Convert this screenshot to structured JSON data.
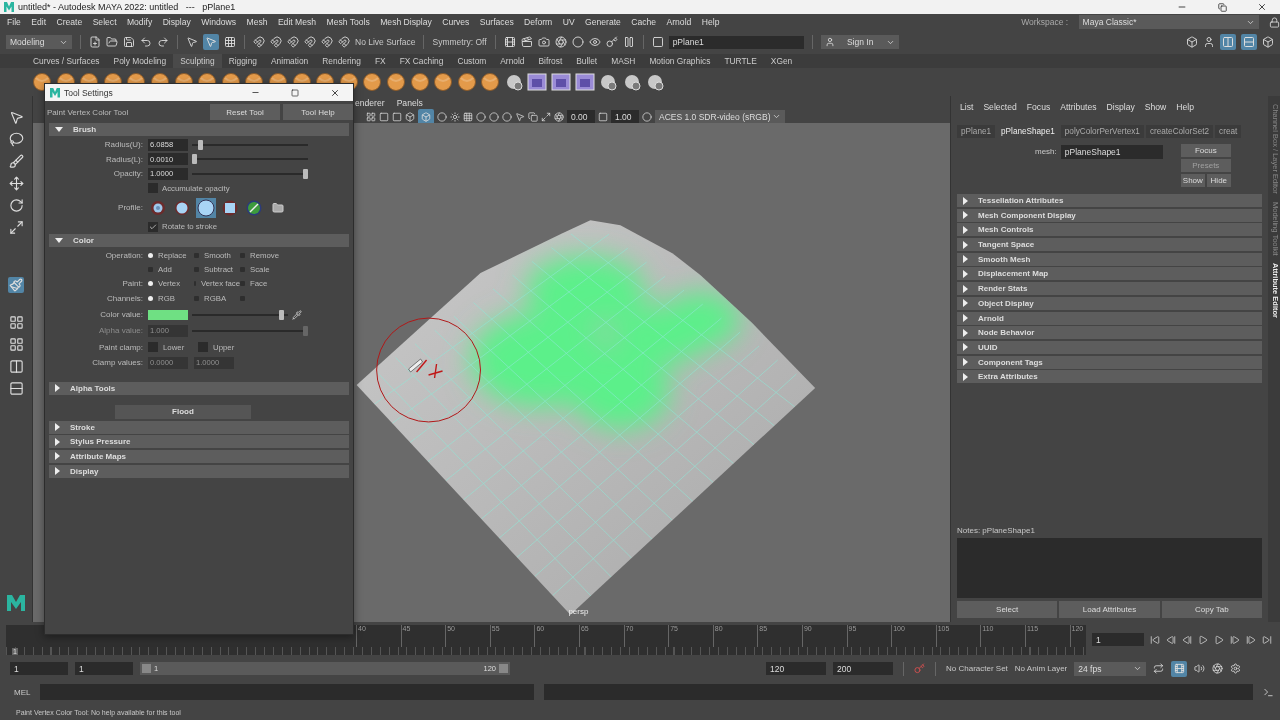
{
  "window": {
    "title": "untitled* - Autodesk MAYA 2022: untitled   ---   pPlane1"
  },
  "menu": [
    "File",
    "Edit",
    "Create",
    "Select",
    "Modify",
    "Display",
    "Windows",
    "Mesh",
    "Edit Mesh",
    "Mesh Tools",
    "Mesh Display",
    "Curves",
    "Surfaces",
    "Deform",
    "UV",
    "Generate",
    "Cache",
    "Arnold",
    "Help"
  ],
  "workspace": {
    "label": "Workspace :",
    "value": "Maya Classic*"
  },
  "status_line": {
    "mode": "Modeling",
    "live_surface": "No Live Surface",
    "symmetry": "Symmetry: Off",
    "object_field": "pPlane1",
    "sign_in": "Sign In"
  },
  "shelf_tabs": [
    {
      "label": "Curves / Surfaces",
      "selected": false
    },
    {
      "label": "Poly Modeling",
      "selected": false
    },
    {
      "label": "Sculpting",
      "selected": true
    },
    {
      "label": "Rigging",
      "selected": false
    },
    {
      "label": "Animation",
      "selected": false
    },
    {
      "label": "Rendering",
      "selected": false
    },
    {
      "label": "FX",
      "selected": false
    },
    {
      "label": "FX Caching",
      "selected": false
    },
    {
      "label": "Custom",
      "selected": false
    },
    {
      "label": "Arnold",
      "selected": false
    },
    {
      "label": "Bifrost",
      "selected": false
    },
    {
      "label": "Bullet",
      "selected": false
    },
    {
      "label": "MASH",
      "selected": false
    },
    {
      "label": "Motion Graphics",
      "selected": false
    },
    {
      "label": "TURTLE",
      "selected": false
    },
    {
      "label": "XGen",
      "selected": false
    }
  ],
  "viewport": {
    "menu": [
      "enderer",
      "Panels"
    ],
    "exposure": "0.00",
    "gamma": "1.00",
    "color_space": "ACES 1.0 SDR-video (sRGB)",
    "camera": "persp"
  },
  "tool_settings": {
    "title": "Tool Settings",
    "tool_name": "Paint Vertex Color Tool",
    "buttons": [
      "Reset Tool",
      "Tool Help"
    ],
    "brush": {
      "label": "Brush",
      "expanded": true,
      "sliders": [
        {
          "label": "Radius(U):",
          "value": "6.0858",
          "level": 0.05
        },
        {
          "label": "Radius(L):",
          "value": "0.0010",
          "level": 0.0
        },
        {
          "label": "Opacity:",
          "value": "1.0000",
          "level": 1.0
        }
      ],
      "accumulate": {
        "label": "Accumulate opacity",
        "checked": false
      },
      "profile": {
        "label": "Profile:",
        "shapes": [
          {
            "kind": "gaussian",
            "selected": false
          },
          {
            "kind": "soft",
            "selected": false
          },
          {
            "kind": "solid",
            "selected": true
          },
          {
            "kind": "square",
            "selected": false
          },
          {
            "kind": "image",
            "selected": false
          },
          {
            "kind": "folder",
            "selected": false
          }
        ]
      },
      "rotate": {
        "label": "Rotate to stroke",
        "checked": true
      }
    },
    "color": {
      "label": "Color",
      "expanded": true,
      "radio_groups": [
        {
          "label": "Operation:",
          "options": [
            {
              "label": "Replace",
              "selected": true
            },
            {
              "label": "Smooth",
              "selected": false
            },
            {
              "label": "Remove",
              "selected": false
            },
            {
              "label": "Add",
              "selected": false
            },
            {
              "label": "Subtract",
              "selected": false
            },
            {
              "label": "Scale",
              "selected": false
            }
          ]
        },
        {
          "label": "Paint:",
          "options": [
            {
              "label": "Vertex",
              "selected": true
            },
            {
              "label": "Vertex face",
              "selected": false
            },
            {
              "label": "Face",
              "selected": false
            }
          ]
        },
        {
          "label": "Channels:",
          "options": [
            {
              "label": "RGB",
              "selected": true
            },
            {
              "label": "RGBA",
              "selected": false
            },
            {
              "selected": false
            }
          ]
        }
      ],
      "color_value": {
        "label": "Color value:",
        "color": "#6fe083",
        "level": 0.96
      },
      "alpha_value": {
        "label": "Alpha value:",
        "value": "1.000",
        "level": 1.0,
        "disabled": true
      },
      "paint_clamp": {
        "label": "Paint clamp:",
        "options": [
          {
            "label": "Lower",
            "checked": false
          },
          {
            "label": "Upper",
            "checked": false
          }
        ]
      },
      "clamp_values": {
        "label": "Clamp values:",
        "values": [
          "0.0000",
          "1.0000"
        ],
        "disabled": true
      }
    },
    "alpha_tools": {
      "label": "Alpha Tools",
      "expanded": false
    },
    "flood": "Flood",
    "collapsed_sections": [
      {
        "label": "Stroke",
        "expanded": false
      },
      {
        "label": "Stylus Pressure",
        "expanded": false
      },
      {
        "label": "Attribute Maps",
        "expanded": false
      },
      {
        "label": "Display",
        "expanded": false
      }
    ]
  },
  "attribute_editor": {
    "menu": [
      "List",
      "Selected",
      "Focus",
      "Attributes",
      "Display",
      "Show",
      "Help"
    ],
    "tabs": [
      {
        "label": "pPlane1",
        "selected": false
      },
      {
        "label": "pPlaneShape1",
        "selected": true
      },
      {
        "label": "polyColorPerVertex1",
        "selected": false
      },
      {
        "label": "createColorSet2",
        "selected": false
      },
      {
        "label": "creat",
        "selected": false
      }
    ],
    "mesh_label": "mesh:",
    "mesh_value": "pPlaneShape1",
    "side_buttons": [
      {
        "label": "Focus",
        "disabled": false
      },
      {
        "label": "Presets",
        "disabled": true
      },
      {
        "label": "Show",
        "disabled": false
      },
      {
        "label": "Hide",
        "disabled": false
      }
    ],
    "sections": [
      {
        "label": "Tessellation Attributes",
        "expanded": false
      },
      {
        "label": "Mesh Component Display",
        "expanded": false
      },
      {
        "label": "Mesh Controls",
        "expanded": false
      },
      {
        "label": "Tangent Space",
        "expanded": false
      },
      {
        "label": "Smooth Mesh",
        "expanded": false
      },
      {
        "label": "Displacement Map",
        "expanded": false
      },
      {
        "label": "Render Stats",
        "expanded": false
      },
      {
        "label": "Object Display",
        "expanded": false
      },
      {
        "label": "Arnold",
        "expanded": false
      },
      {
        "label": "Node Behavior",
        "expanded": false
      },
      {
        "label": "UUID",
        "expanded": false
      },
      {
        "label": "Component Tags",
        "expanded": false
      },
      {
        "label": "Extra Attributes",
        "expanded": false
      }
    ],
    "notes_label": "Notes:  pPlaneShape1",
    "bottom_buttons": [
      "Select",
      "Load Attributes",
      "Copy Tab"
    ]
  },
  "side_tabs": [
    {
      "label": "Channel Box / Layer Editor",
      "selected": false
    },
    {
      "label": "Modeling Toolkit",
      "selected": false
    },
    {
      "label": "Attribute Editor",
      "selected": true
    }
  ],
  "timeline": {
    "start_label": "1",
    "level": 0.0,
    "ticks": [
      "40",
      "45",
      "50",
      "55",
      "60",
      "65",
      "70",
      "75",
      "80",
      "85",
      "90",
      "95",
      "100",
      "105",
      "110",
      "115",
      "120"
    ],
    "current_frame": "1"
  },
  "range": {
    "start": "1",
    "level": 1.0,
    "playback_start": "1",
    "slider_start": "1",
    "slider_end": "120",
    "playback_end": "120",
    "end": "200",
    "character_set": "No Character Set",
    "anim_layer": "No Anim Layer",
    "fps": "24 fps"
  },
  "command_line": {
    "label": "MEL"
  },
  "help_line": "Paint Vertex Color Tool: No help available for this tool"
}
